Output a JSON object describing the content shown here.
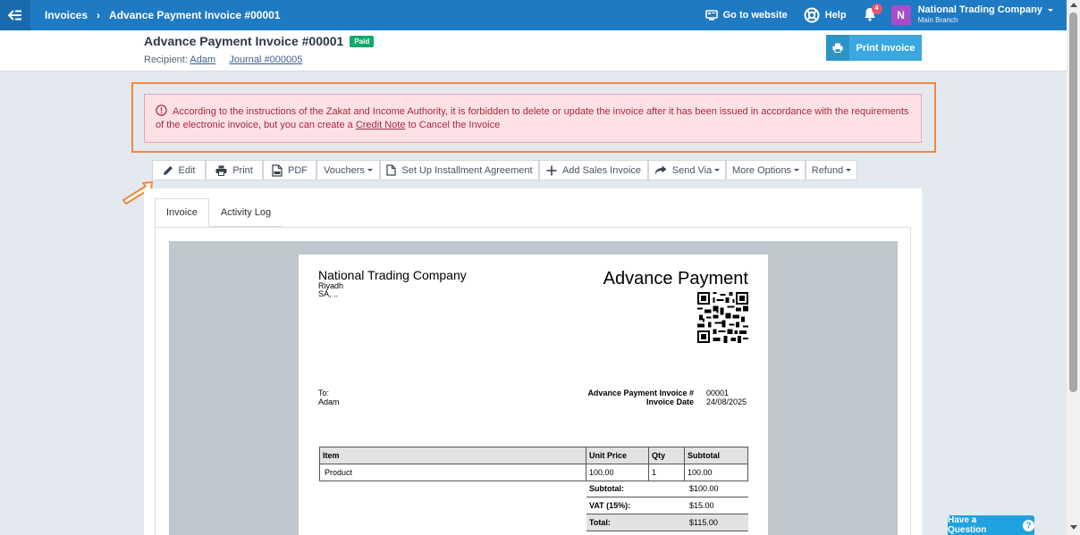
{
  "topbar": {
    "breadcrumb_root": "Invoices",
    "breadcrumb_current": "Advance Payment Invoice #00001",
    "go_to_website": "Go to website",
    "help": "Help",
    "notifications_count": "4",
    "avatar_letter": "N",
    "company_name": "National Trading Company",
    "branch": "Main Branch"
  },
  "header": {
    "title": "Advance Payment Invoice #00001",
    "status": "Paid",
    "recipient_label": "Recipient:",
    "recipient_name": "Adam",
    "journal_link": "Journal #000005",
    "print_button": "Print Invoice"
  },
  "alert": {
    "text_before": "According to the instructions of the Zakat and Income Authority, it is forbidden to delete or update the invoice after it has been issued in accordance with the requirements of the electronic invoice, but you can create a",
    "link": "Credit Note",
    "text_after": "to Cancel the Invoice"
  },
  "toolbar": {
    "edit": "Edit",
    "print": "Print",
    "pdf": "PDF",
    "vouchers": "Vouchers",
    "installment": "Set Up Installment Agreement",
    "add_sales": "Add Sales Invoice",
    "send_via": "Send Via",
    "more_options": "More Options",
    "refund": "Refund"
  },
  "tabs": {
    "invoice": "Invoice",
    "activity_log": "Activity Log"
  },
  "invoice": {
    "company_name": "National Trading Company",
    "city": "Riyadh",
    "country": "SA, ..",
    "doc_title": "Advance Payment",
    "to_label": "To:",
    "to_name": "Adam",
    "number_label": "Advance Payment Invoice #",
    "number_value": "00001",
    "date_label": "Invoice Date",
    "date_value": "24/08/2025",
    "columns": {
      "item": "Item",
      "unit_price": "Unit Price",
      "qty": "Qty",
      "subtotal": "Subtotal"
    },
    "rows": [
      {
        "item": "Product",
        "unit_price": "100.00",
        "qty": "1",
        "subtotal": "100.00"
      }
    ],
    "totals": {
      "subtotal_label": "Subtotal:",
      "subtotal_value": "$100.00",
      "vat_label": "VAT (15%):",
      "vat_value": "$15.00",
      "total_label": "Total:",
      "total_value": "$115.00"
    }
  },
  "help_widget": "Have a Question",
  "help_widget_icon": "?",
  "colors": {
    "topbar": "#1f7ac4",
    "paid": "#13a96b",
    "alert_bg": "#fde1e5",
    "alert_text": "#a8283d",
    "highlight": "#f2883a",
    "print_button": "#39a8e0"
  }
}
